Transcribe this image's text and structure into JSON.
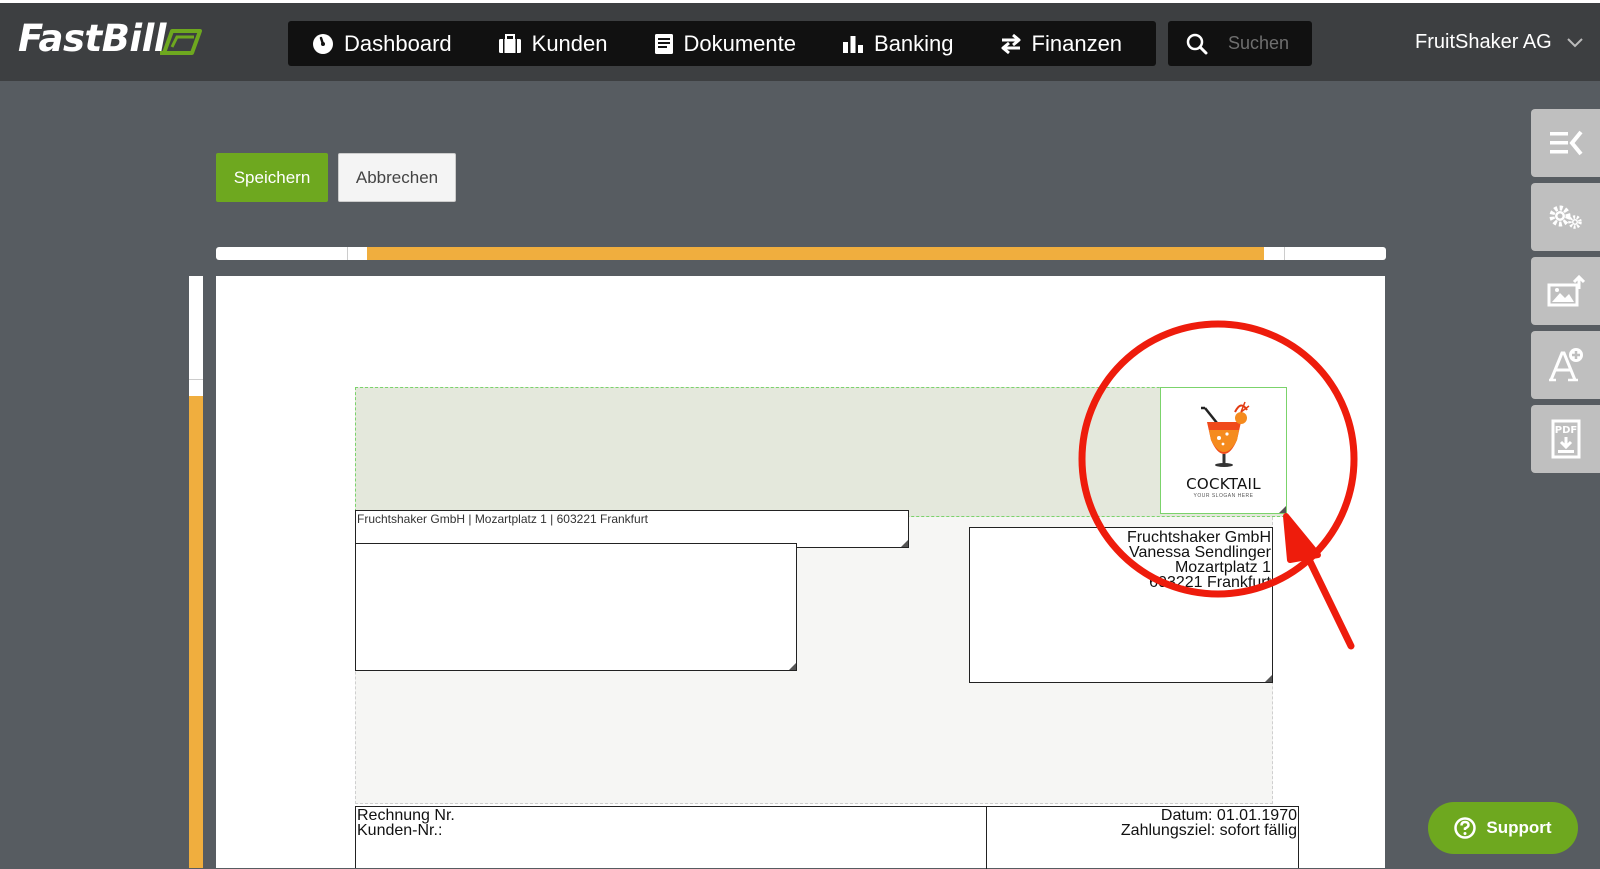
{
  "app": {
    "logo_text": "FastBill"
  },
  "nav": {
    "items": [
      {
        "label": "Dashboard",
        "icon": "dashboard-icon"
      },
      {
        "label": "Kunden",
        "icon": "briefcase-icon"
      },
      {
        "label": "Dokumente",
        "icon": "document-icon"
      },
      {
        "label": "Banking",
        "icon": "bar-chart-icon"
      },
      {
        "label": "Finanzen",
        "icon": "transfer-arrows-icon"
      }
    ]
  },
  "search": {
    "placeholder": "Suchen"
  },
  "account": {
    "name": "FruitShaker AG"
  },
  "toolbar": {
    "save_label": "Speichern",
    "cancel_label": "Abbrechen"
  },
  "document": {
    "logo": {
      "title": "COCKTAIL",
      "slogan": "YOUR SLOGAN HERE"
    },
    "sender_line": "Fruchtshaker GmbH | Mozartplatz 1 | 603221 Frankfurt",
    "address": {
      "line1": "Fruchtshaker GmbH",
      "line2": "Vanessa Sendlinger",
      "line3": "Mozartplatz 1",
      "line4": "603221 Frankfurt"
    },
    "info": {
      "invoice_no_label": "Rechnung Nr.",
      "customer_no_label": "Kunden-Nr.:",
      "date_label": "Datum: 01.01.1970",
      "payment_label": "Zahlungsziel: sofort fällig"
    }
  },
  "sidebar": {
    "buttons": [
      {
        "icon": "collapse-panel-icon"
      },
      {
        "icon": "settings-gears-icon"
      },
      {
        "icon": "image-upload-icon"
      },
      {
        "icon": "add-font-icon"
      },
      {
        "icon": "pdf-download-icon"
      }
    ]
  },
  "support": {
    "label": "Support"
  },
  "colors": {
    "brand_green": "#6ea81f",
    "ruler_orange": "#f0ae3e",
    "annotation_red": "#ee1c0c",
    "topbar": "#3d3f41"
  }
}
